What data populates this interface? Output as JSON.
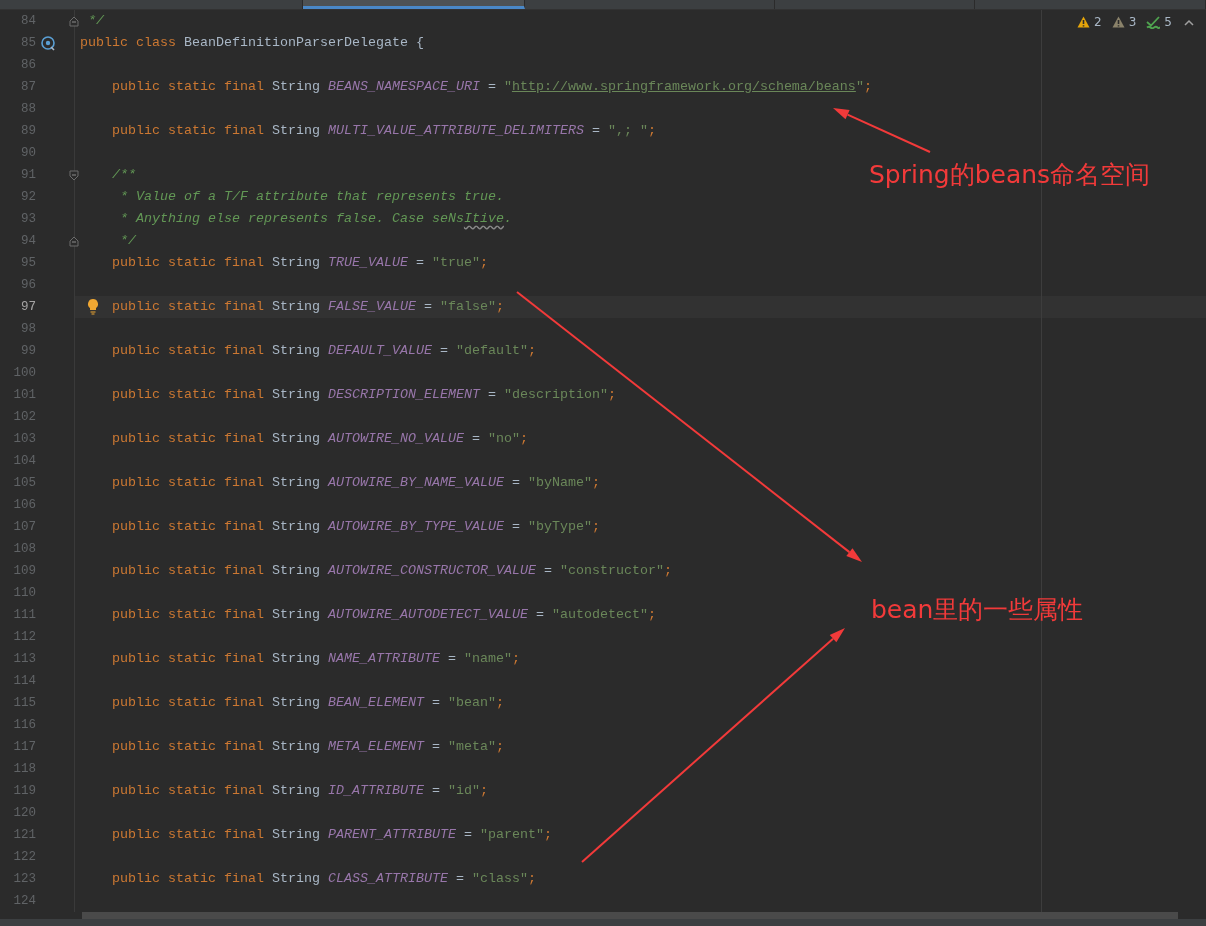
{
  "tabs": [
    {
      "selected": false
    },
    {
      "selected": true
    },
    {
      "selected": false
    },
    {
      "selected": false
    },
    {
      "selected": false
    }
  ],
  "inspections": [
    {
      "kind": "warning",
      "count": "2"
    },
    {
      "kind": "weak_warning",
      "count": "3"
    },
    {
      "kind": "typo",
      "count": "5"
    }
  ],
  "lines": [
    {
      "number": "84",
      "current": false,
      "gutter": {
        "kind": "fold_end"
      },
      "tokens": [
        {
          "kind": "comment",
          "text": " */"
        }
      ]
    },
    {
      "number": "85",
      "current": false,
      "gutter": {
        "kind": "implemented"
      },
      "tokens": [
        {
          "kind": "keyword",
          "text": "public class"
        },
        {
          "kind": "plain",
          "text": " BeanDefinitionParserDelegate {"
        }
      ]
    },
    {
      "number": "86",
      "current": false
    },
    {
      "number": "87",
      "current": false,
      "tokens": [
        {
          "kind": "keyword",
          "text": "    public static final"
        },
        {
          "kind": "plain",
          "text": " String "
        },
        {
          "kind": "constant",
          "text": "BEANS_NAMESPACE_URI"
        },
        {
          "kind": "plain",
          "text": " = "
        },
        {
          "kind": "string",
          "text": "\""
        },
        {
          "kind": "link",
          "text": "http://www.springframework.org/schema/beans"
        },
        {
          "kind": "string",
          "text": "\""
        },
        {
          "kind": "keyword",
          "text": ";"
        }
      ]
    },
    {
      "number": "88",
      "current": false
    },
    {
      "number": "89",
      "current": false,
      "tokens": [
        {
          "kind": "keyword",
          "text": "    public static final"
        },
        {
          "kind": "plain",
          "text": " String "
        },
        {
          "kind": "constant",
          "text": "MULTI_VALUE_ATTRIBUTE_DELIMITERS"
        },
        {
          "kind": "plain",
          "text": " = "
        },
        {
          "kind": "string",
          "text": "\",; \""
        },
        {
          "kind": "keyword",
          "text": ";"
        }
      ]
    },
    {
      "number": "90",
      "current": false
    },
    {
      "number": "91",
      "current": false,
      "gutter": {
        "kind": "fold_start"
      },
      "tokens": [
        {
          "kind": "comment",
          "text": "    /**"
        }
      ]
    },
    {
      "number": "92",
      "current": false,
      "tokens": [
        {
          "kind": "comment",
          "text": "     * Value of a T/F attribute that represents true."
        }
      ]
    },
    {
      "number": "93",
      "current": false,
      "tokens": [
        {
          "kind": "comment",
          "text": "     * Anything else represents false. Case seNs"
        },
        {
          "kind": "typo",
          "text": "Itive"
        },
        {
          "kind": "comment",
          "text": "."
        }
      ]
    },
    {
      "number": "94",
      "current": false,
      "gutter": {
        "kind": "fold_end"
      },
      "tokens": [
        {
          "kind": "comment",
          "text": "     */"
        }
      ]
    },
    {
      "number": "95",
      "current": false,
      "tokens": [
        {
          "kind": "keyword",
          "text": "    public static final"
        },
        {
          "kind": "plain",
          "text": " String "
        },
        {
          "kind": "constant",
          "text": "TRUE_VALUE"
        },
        {
          "kind": "plain",
          "text": " = "
        },
        {
          "kind": "string",
          "text": "\"true\""
        },
        {
          "kind": "keyword",
          "text": ";"
        }
      ]
    },
    {
      "number": "96",
      "current": false
    },
    {
      "number": "97",
      "current": true,
      "tokens": [
        {
          "kind": "keyword",
          "text": "    public static final"
        },
        {
          "kind": "plain",
          "text": " String "
        },
        {
          "kind": "constant",
          "text": "FALSE_VALUE"
        },
        {
          "kind": "plain",
          "text": " = "
        },
        {
          "kind": "string",
          "text": "\"false\""
        },
        {
          "kind": "keyword",
          "text": ";"
        }
      ]
    },
    {
      "number": "98",
      "current": false
    },
    {
      "number": "99",
      "current": false,
      "tokens": [
        {
          "kind": "keyword",
          "text": "    public static final"
        },
        {
          "kind": "plain",
          "text": " String "
        },
        {
          "kind": "constant",
          "text": "DEFAULT_VALUE"
        },
        {
          "kind": "plain",
          "text": " = "
        },
        {
          "kind": "string",
          "text": "\"default\""
        },
        {
          "kind": "keyword",
          "text": ";"
        }
      ]
    },
    {
      "number": "100",
      "current": false
    },
    {
      "number": "101",
      "current": false,
      "tokens": [
        {
          "kind": "keyword",
          "text": "    public static final"
        },
        {
          "kind": "plain",
          "text": " String "
        },
        {
          "kind": "constant",
          "text": "DESCRIPTION_ELEMENT"
        },
        {
          "kind": "plain",
          "text": " = "
        },
        {
          "kind": "string",
          "text": "\"description\""
        },
        {
          "kind": "keyword",
          "text": ";"
        }
      ]
    },
    {
      "number": "102",
      "current": false
    },
    {
      "number": "103",
      "current": false,
      "tokens": [
        {
          "kind": "keyword",
          "text": "    public static final"
        },
        {
          "kind": "plain",
          "text": " String "
        },
        {
          "kind": "constant",
          "text": "AUTOWIRE_NO_VALUE"
        },
        {
          "kind": "plain",
          "text": " = "
        },
        {
          "kind": "string",
          "text": "\"no\""
        },
        {
          "kind": "keyword",
          "text": ";"
        }
      ]
    },
    {
      "number": "104",
      "current": false
    },
    {
      "number": "105",
      "current": false,
      "tokens": [
        {
          "kind": "keyword",
          "text": "    public static final"
        },
        {
          "kind": "plain",
          "text": " String "
        },
        {
          "kind": "constant",
          "text": "AUTOWIRE_BY_NAME_VALUE"
        },
        {
          "kind": "plain",
          "text": " = "
        },
        {
          "kind": "string",
          "text": "\"byName\""
        },
        {
          "kind": "keyword",
          "text": ";"
        }
      ]
    },
    {
      "number": "106",
      "current": false
    },
    {
      "number": "107",
      "current": false,
      "tokens": [
        {
          "kind": "keyword",
          "text": "    public static final"
        },
        {
          "kind": "plain",
          "text": " String "
        },
        {
          "kind": "constant",
          "text": "AUTOWIRE_BY_TYPE_VALUE"
        },
        {
          "kind": "plain",
          "text": " = "
        },
        {
          "kind": "string",
          "text": "\"byType\""
        },
        {
          "kind": "keyword",
          "text": ";"
        }
      ]
    },
    {
      "number": "108",
      "current": false
    },
    {
      "number": "109",
      "current": false,
      "tokens": [
        {
          "kind": "keyword",
          "text": "    public static final"
        },
        {
          "kind": "plain",
          "text": " String "
        },
        {
          "kind": "constant",
          "text": "AUTOWIRE_CONSTRUCTOR_VALUE"
        },
        {
          "kind": "plain",
          "text": " = "
        },
        {
          "kind": "string",
          "text": "\"constructor\""
        },
        {
          "kind": "keyword",
          "text": ";"
        }
      ]
    },
    {
      "number": "110",
      "current": false
    },
    {
      "number": "111",
      "current": false,
      "tokens": [
        {
          "kind": "keyword",
          "text": "    public static final"
        },
        {
          "kind": "plain",
          "text": " String "
        },
        {
          "kind": "constant",
          "text": "AUTOWIRE_AUTODETECT_VALUE"
        },
        {
          "kind": "plain",
          "text": " = "
        },
        {
          "kind": "string",
          "text": "\"autodetect\""
        },
        {
          "kind": "keyword",
          "text": ";"
        }
      ]
    },
    {
      "number": "112",
      "current": false
    },
    {
      "number": "113",
      "current": false,
      "tokens": [
        {
          "kind": "keyword",
          "text": "    public static final"
        },
        {
          "kind": "plain",
          "text": " String "
        },
        {
          "kind": "constant",
          "text": "NAME_ATTRIBUTE"
        },
        {
          "kind": "plain",
          "text": " = "
        },
        {
          "kind": "string",
          "text": "\"name\""
        },
        {
          "kind": "keyword",
          "text": ";"
        }
      ]
    },
    {
      "number": "114",
      "current": false
    },
    {
      "number": "115",
      "current": false,
      "tokens": [
        {
          "kind": "keyword",
          "text": "    public static final"
        },
        {
          "kind": "plain",
          "text": " String "
        },
        {
          "kind": "constant",
          "text": "BEAN_ELEMENT"
        },
        {
          "kind": "plain",
          "text": " = "
        },
        {
          "kind": "string",
          "text": "\"bean\""
        },
        {
          "kind": "keyword",
          "text": ";"
        }
      ]
    },
    {
      "number": "116",
      "current": false
    },
    {
      "number": "117",
      "current": false,
      "tokens": [
        {
          "kind": "keyword",
          "text": "    public static final"
        },
        {
          "kind": "plain",
          "text": " String "
        },
        {
          "kind": "constant",
          "text": "META_ELEMENT"
        },
        {
          "kind": "plain",
          "text": " = "
        },
        {
          "kind": "string",
          "text": "\"meta\""
        },
        {
          "kind": "keyword",
          "text": ";"
        }
      ]
    },
    {
      "number": "118",
      "current": false
    },
    {
      "number": "119",
      "current": false,
      "tokens": [
        {
          "kind": "keyword",
          "text": "    public static final"
        },
        {
          "kind": "plain",
          "text": " String "
        },
        {
          "kind": "constant",
          "text": "ID_ATTRIBUTE"
        },
        {
          "kind": "plain",
          "text": " = "
        },
        {
          "kind": "string",
          "text": "\"id\""
        },
        {
          "kind": "keyword",
          "text": ";"
        }
      ]
    },
    {
      "number": "120",
      "current": false
    },
    {
      "number": "121",
      "current": false,
      "tokens": [
        {
          "kind": "keyword",
          "text": "    public static final"
        },
        {
          "kind": "plain",
          "text": " String "
        },
        {
          "kind": "constant",
          "text": "PARENT_ATTRIBUTE"
        },
        {
          "kind": "plain",
          "text": " = "
        },
        {
          "kind": "string",
          "text": "\"parent\""
        },
        {
          "kind": "keyword",
          "text": ";"
        }
      ]
    },
    {
      "number": "122",
      "current": false
    },
    {
      "number": "123",
      "current": false,
      "tokens": [
        {
          "kind": "keyword",
          "text": "    public static final"
        },
        {
          "kind": "plain",
          "text": " String "
        },
        {
          "kind": "constant",
          "text": "CLASS_ATTRIBUTE"
        },
        {
          "kind": "plain",
          "text": " = "
        },
        {
          "kind": "string",
          "text": "\"class\""
        },
        {
          "kind": "keyword",
          "text": ";"
        }
      ]
    },
    {
      "number": "124",
      "current": false
    }
  ],
  "annotations": [
    {
      "text": "Spring的beans命名空间"
    },
    {
      "text": "bean里的一些属性"
    }
  ]
}
